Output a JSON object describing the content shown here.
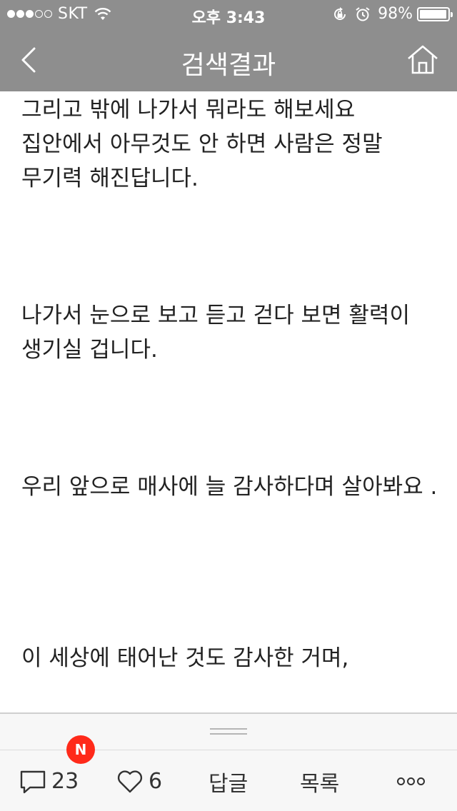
{
  "status_bar": {
    "carrier": "SKT",
    "time": "오후 3:43",
    "battery": "98%",
    "signal_full": 3,
    "signal_total": 5
  },
  "nav": {
    "title": "검색결과",
    "back_icon": "chevron-left-icon",
    "home_icon": "home-icon"
  },
  "content": {
    "paragraphs": [
      "그리고 밖에 나가서 뭐라도 해보세요 집안에서 아무것도 안 하면 사람은 정말 무기력 해진답니다.",
      "나가서 눈으로 보고 듣고 걷다 보면 활력이 생기실 겁니다.",
      "우리 앞으로 매사에 늘 감사하다며 살아봐요 .",
      "이 세상에 태어난 것도 감사한 거며,"
    ]
  },
  "bottom_bar": {
    "new_badge": "N",
    "comment_count": "23",
    "like_count": "6",
    "reply_label": "답글",
    "list_label": "목록",
    "more_icon": "more-dots-icon"
  },
  "colors": {
    "topbar": "#8e8e8e",
    "badge": "#ff2a1a",
    "text": "#222222"
  }
}
